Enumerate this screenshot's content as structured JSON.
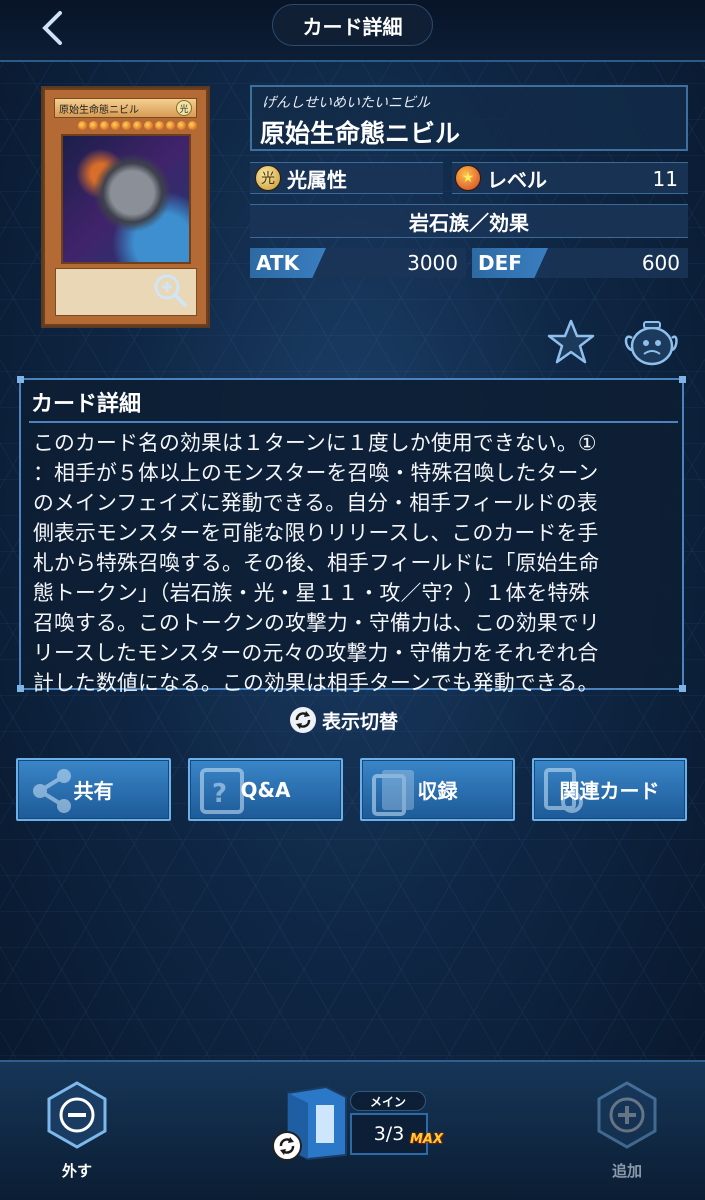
{
  "header": {
    "title": "カード詳細"
  },
  "card_image": {
    "mini_name": "原始生命態ニビル",
    "mini_attr": "光",
    "level_stars": 11
  },
  "card": {
    "ruby": "げんしせいめいたいニビル",
    "name": "原始生命態ニビル",
    "attribute": "光属性",
    "attribute_icon": "光",
    "level_label": "レベル",
    "level_value": "11",
    "type": "岩石族／効果",
    "atk_label": "ATK",
    "atk_value": "3000",
    "def_label": "DEF",
    "def_value": "600"
  },
  "detail": {
    "title": "カード詳細",
    "text": "このカード名の効果は１ターンに１度しか使用できない。①\n：相手が５体以上のモンスターを召喚・特殊召喚したターン\nのメインフェイズに発動できる。自分・相手フィールドの表\n側表示モンスターを可能な限りリリースし、このカードを手\n札から特殊召喚する。その後、相手フィールドに「原始生命\n態トークン」（岩石族・光・星１１・攻／守？）１体を特殊\n召喚する。このトークンの攻撃力・守備力は、この効果でリ\nリースしたモンスターの元々の攻撃力・守備力をそれぞれ合\n計した数値になる。この効果は相手ターンでも発動できる。"
  },
  "toggle": {
    "label": "表示切替"
  },
  "actions": [
    {
      "label": "共有",
      "icon": "share-icon"
    },
    {
      "label": "Q&A",
      "icon": "qa-icon"
    },
    {
      "label": "収録",
      "icon": "pack-icon"
    },
    {
      "label": "関連カード",
      "icon": "related-cards-icon"
    }
  ],
  "bottom": {
    "remove_label": "外す",
    "add_label": "追加",
    "deck_tag": "メイン",
    "deck_count": "3/3",
    "max_badge": "MAX"
  },
  "colors": {
    "accent": "#3a86c8",
    "panel_border": "#4a83bd",
    "background": "#0b1d33"
  }
}
